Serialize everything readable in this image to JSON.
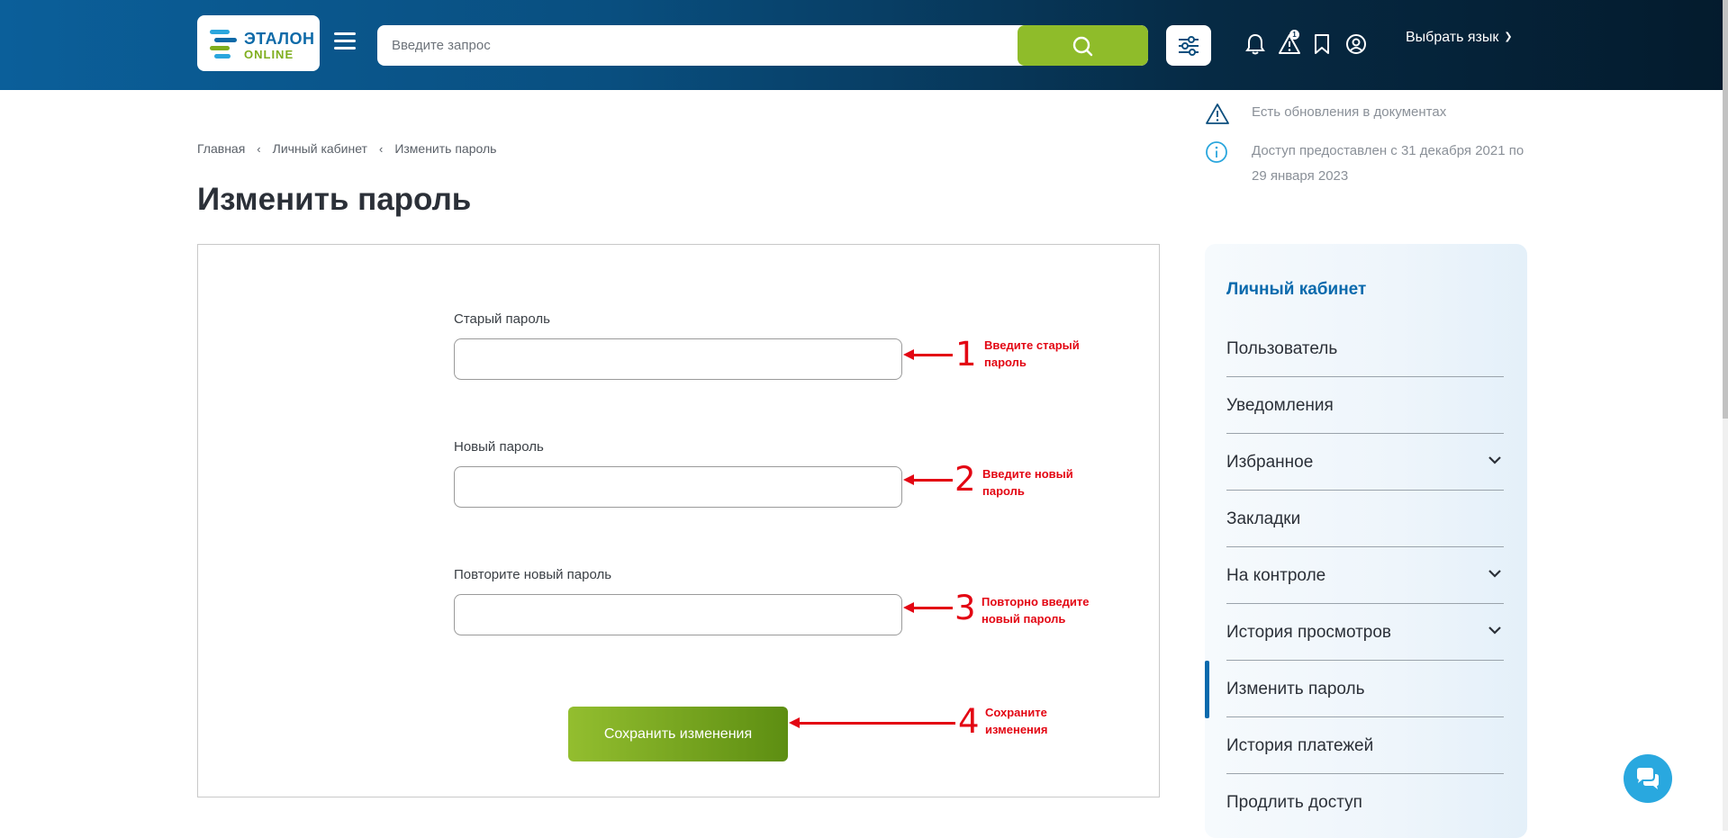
{
  "header": {
    "logo": {
      "title": "ЭТАЛОН",
      "subtitle": "ONLINE"
    },
    "search": {
      "placeholder": "Введите запрос"
    },
    "language": {
      "label": "Выбрать язык"
    },
    "alerts_badge": "1"
  },
  "notices": [
    {
      "text": "Есть обновления в документах",
      "icon": "warning-icon"
    },
    {
      "text": "Доступ предоставлен с 31 декабря 2021 по 29 января 2023",
      "icon": "info-icon"
    }
  ],
  "breadcrumb": [
    "Главная",
    "Личный кабинет",
    "Изменить пароль"
  ],
  "page": {
    "title": "Изменить пароль"
  },
  "form": {
    "old_password": {
      "label": "Старый пароль",
      "value": ""
    },
    "new_password": {
      "label": "Новый пароль",
      "value": ""
    },
    "repeat_password": {
      "label": "Повторите новый пароль",
      "value": ""
    },
    "save_label": "Сохранить изменения"
  },
  "annotations": [
    {
      "number": "1",
      "text": "Введите старый пароль"
    },
    {
      "number": "2",
      "text": "Введите новый пароль"
    },
    {
      "number": "3",
      "text": "Повторно введите новый пароль"
    },
    {
      "number": "4",
      "text": "Сохраните изменения"
    }
  ],
  "sidebar": {
    "title": "Личный кабинет",
    "items": [
      {
        "label": "Пользователь",
        "expandable": false
      },
      {
        "label": "Уведомления",
        "expandable": false
      },
      {
        "label": "Избранное",
        "expandable": true
      },
      {
        "label": "Закладки",
        "expandable": false
      },
      {
        "label": "На контроле",
        "expandable": true
      },
      {
        "label": "История просмотров",
        "expandable": true
      },
      {
        "label": "Изменить пароль",
        "expandable": false,
        "active": true
      },
      {
        "label": "История платежей",
        "expandable": false
      },
      {
        "label": "Продлить доступ",
        "expandable": false
      }
    ]
  },
  "colors": {
    "brand_blue": "#0a6aad",
    "brand_green": "#8fbc2a",
    "annotation_red": "#e30613"
  }
}
